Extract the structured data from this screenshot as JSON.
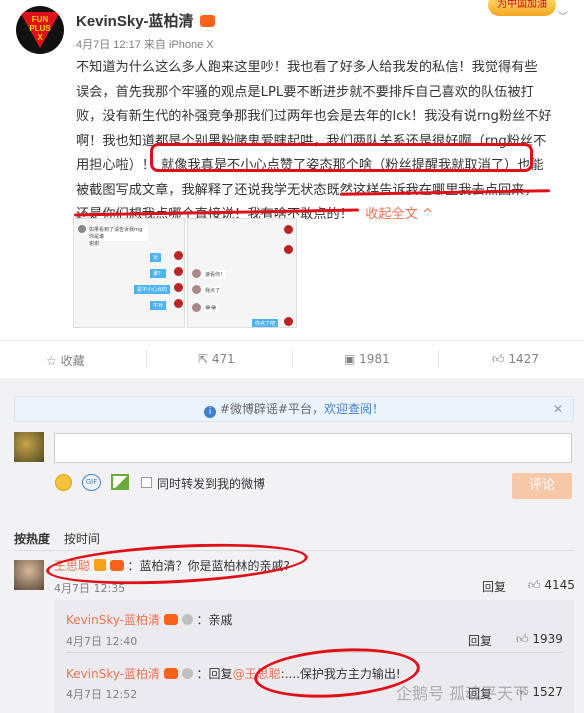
{
  "post": {
    "author": "KevinSky-蓝柏清",
    "time": "4月7日 12:17",
    "source": "来自 iPhone X",
    "top_badge": "为中国加油",
    "avatar_text": [
      "FUN",
      "PLUS",
      "X"
    ],
    "lines": [
      "不知道为什么这么多人跑来这里吵！我也看了好多人给我发的私信！我觉得有些",
      "误会，首先我那个牢骚的观点是LPL要不断进步就不要排斥自己喜欢的队伍被打",
      "败，没有新生代的补强竞争那我们过两年也会是去年的lck！我没有说rng粉丝不好",
      "啊！我也知道都是个别黑粉赌鬼爱瞎起哄，我们两队关系还是很好啊（rng粉丝不",
      "用担心啦）！",
      "就像我真是不小心点赞了姿态那个啥（粉丝提醒我就取消了）",
      "也能",
      "被截图写成文章，我解释了还说我学无状态",
      "既然这样告诉我在哪里我去点回来，",
      "还是你们想我点哪个直接说！我有啥不敢点的！",
      "收起全文"
    ],
    "collapse_arrow": "^"
  },
  "chat_screens": {
    "left": {
      "msgs": [
        "如果看到了请告诉我rng你是谁",
        "谢谢",
        "对",
        "谁？",
        "是不小心点的",
        "不对"
      ]
    },
    "right": {
      "msgs": [
        "速看你！",
        "我点了",
        "你点了吧",
        "😂😂"
      ]
    }
  },
  "actions": {
    "fav_label": "收藏",
    "repost_count": "471",
    "comment_count": "1981",
    "like_count": "1427"
  },
  "notice": {
    "text": "#微博辟谣#平台，",
    "link": "欢迎查阅！",
    "close": "✕"
  },
  "composer": {
    "placeholder": "",
    "repost_checkbox_label": "同时转发到我的微博",
    "submit": "评论"
  },
  "sort": {
    "by_hot": "按热度",
    "by_time": "按时间"
  },
  "comments": [
    {
      "user": "王思聪",
      "text": "：蓝柏清？你是蓝柏林的亲戚?",
      "time": "4月7日 12:35",
      "reply": "回复",
      "likes": "4145"
    }
  ],
  "replies": [
    {
      "user": "KevinSky-蓝柏清",
      "text": "：亲戚",
      "time": "4月7日 12:40",
      "reply": "回复",
      "likes": "1939"
    },
    {
      "user": "KevinSky-蓝柏清",
      "prefix": "：回复",
      "mention": "@王思聪",
      "text": ":....保护我方主力输出!",
      "time": "4月7日 12:52",
      "reply": "回复",
      "likes": "1527"
    }
  ],
  "watermark": "企鹅号 孤魂平天下",
  "colors": {
    "accent": "#eb7350",
    "link": "#3e7fcf",
    "annotation": "#e0101a"
  }
}
